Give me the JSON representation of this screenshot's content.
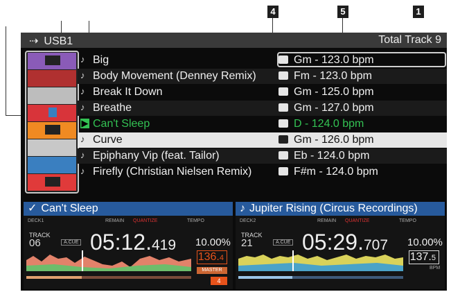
{
  "callouts": {
    "c4": "4",
    "c5": "5",
    "c1": "1"
  },
  "header": {
    "usb_icon": "usb-icon",
    "device": "USB1",
    "total": "Total Track 9"
  },
  "tracks": [
    {
      "title": "Big",
      "key": "Gm - 123.0 bpm"
    },
    {
      "title": "Body Movement (Denney Remix)",
      "key": "Fm - 123.0 bpm"
    },
    {
      "title": "Break It Down",
      "key": "Gm - 125.0 bpm"
    },
    {
      "title": "Breathe",
      "key": "Gm - 127.0 bpm"
    },
    {
      "title": "Can't Sleep",
      "key": "D - 124.0 bpm",
      "state": "loaded"
    },
    {
      "title": "Curve",
      "key": "Gm - 126.0 bpm",
      "state": "selected"
    },
    {
      "title": "Epiphany Vip (feat. Tailor)",
      "key": "Eb - 124.0 bpm"
    },
    {
      "title": "Firefly (Christian Nielsen Remix)",
      "key": "F#m - 124.0 bpm"
    }
  ],
  "thumb_colors": [
    "#8a5bb8",
    "#e03a3a",
    "#c8c8c8",
    "#e03a3a",
    "#f08a22",
    "#c8c8c8",
    "#3a7fc0",
    "#e03a3a"
  ],
  "deck1": {
    "title": "Can't Sleep",
    "deck": "DECK1",
    "remain": "REMAIN",
    "quantize": "QUANTIZE",
    "tempo_lbl": "TEMPO",
    "track_lbl": "TRACK",
    "track_no": "06",
    "acue": "A.CUE",
    "time_main": "05:12.",
    "time_ms": "419",
    "tempo": "10.00",
    "tempo_unit": "%",
    "bpm_int": "136.",
    "bpm_dec": "4",
    "master": "MASTER",
    "sync": "4"
  },
  "deck2": {
    "title": "Jupiter Rising (Circus Recordings)",
    "deck": "DECK2",
    "remain": "REMAIN",
    "quantize": "QUANTIZE",
    "tempo_lbl": "TEMPO",
    "track_lbl": "TRACK",
    "track_no": "21",
    "acue": "A.CUE",
    "time_main": "05:29.",
    "time_ms": "707",
    "tempo": "10.00",
    "tempo_unit": "%",
    "bpm_int": "137.",
    "bpm_dec": "5",
    "bpm_unit": "BPM"
  },
  "colors": {
    "header": "#3a3a3a",
    "deck_title": "#275a9c",
    "loaded": "#33c253",
    "selected_row": "#e6e6e6"
  }
}
